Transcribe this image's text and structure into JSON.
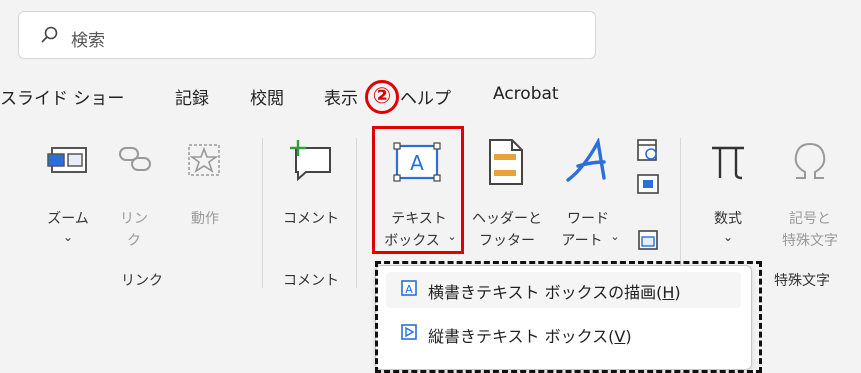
{
  "search": {
    "placeholder": "検索"
  },
  "tabs": [
    "スライド ショー",
    "記録",
    "校閲",
    "表示",
    "ヘルプ",
    "Acrobat"
  ],
  "step_badge": "②",
  "ribbon": {
    "zoom": "ズーム",
    "link": [
      "リン",
      "ク"
    ],
    "action": "動作",
    "comment": "コメント",
    "textbox": [
      "テキスト",
      "ボックス"
    ],
    "header_footer": [
      "ヘッダーと",
      "フッター"
    ],
    "wordart": [
      "ワード",
      "アート"
    ],
    "equation": "数式",
    "symbol": [
      "記号と",
      "特殊文字"
    ],
    "group_link": "リンク",
    "group_comment": "コメント",
    "group_special": "特殊文字"
  },
  "menu": {
    "item1_prefix": "横書きテキスト ボックスの描画(",
    "item1_key": "H",
    "item1_suffix": ")",
    "item2_prefix": "縦書きテキスト ボックス(",
    "item2_key": "V",
    "item2_suffix": ")"
  },
  "colors": {
    "accent": "#2a6fdb",
    "highlight": "#e00000",
    "orange": "#e8a23a",
    "green": "#2e9d3a"
  },
  "icons": [
    "search-icon",
    "zoom-icon",
    "link-icon",
    "action-icon",
    "comment-icon",
    "textbox-icon",
    "header-footer-icon",
    "wordart-icon",
    "datetime-icon",
    "slide-number-icon",
    "object-icon",
    "equation-icon",
    "symbol-icon",
    "horizontal-textbox-icon",
    "vertical-textbox-icon"
  ]
}
